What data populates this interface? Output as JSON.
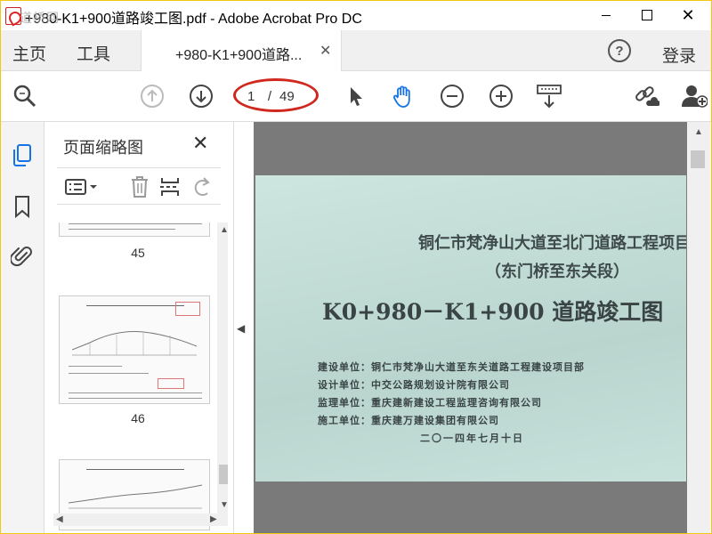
{
  "window": {
    "title": "+980-K1+900道路竣工图.pdf - Adobe Acrobat Pro DC",
    "watermark": "道桥网"
  },
  "menu": {
    "home": "主页",
    "tools": "工具",
    "doc_tab": "+980-K1+900道路...",
    "login": "登录"
  },
  "toolbar": {
    "current_page": "1",
    "separator": "/",
    "total_pages": "49"
  },
  "panel": {
    "title": "页面缩略图",
    "thumbnails": [
      {
        "label": "45"
      },
      {
        "label": "46"
      }
    ]
  },
  "document": {
    "title": "铜仁市梵净山大道至北门道路工程项目",
    "subtitle": "（东门桥至东关段）",
    "main_title": "K0+980－K1+900 道路竣工图",
    "lines": [
      "建设单位：铜仁市梵净山大道至东关道路工程建设项目部",
      "设计单位：中交公路规划设计院有限公司",
      "监理单位：重庆建新建设工程监理咨询有限公司",
      "施工单位：重庆建万建设集团有限公司"
    ],
    "date": "二〇一四年七月十日"
  },
  "colors": {
    "accent_blue": "#1473e6",
    "annotation_red": "#d0281f",
    "page_tint": "#c2dcd6"
  }
}
